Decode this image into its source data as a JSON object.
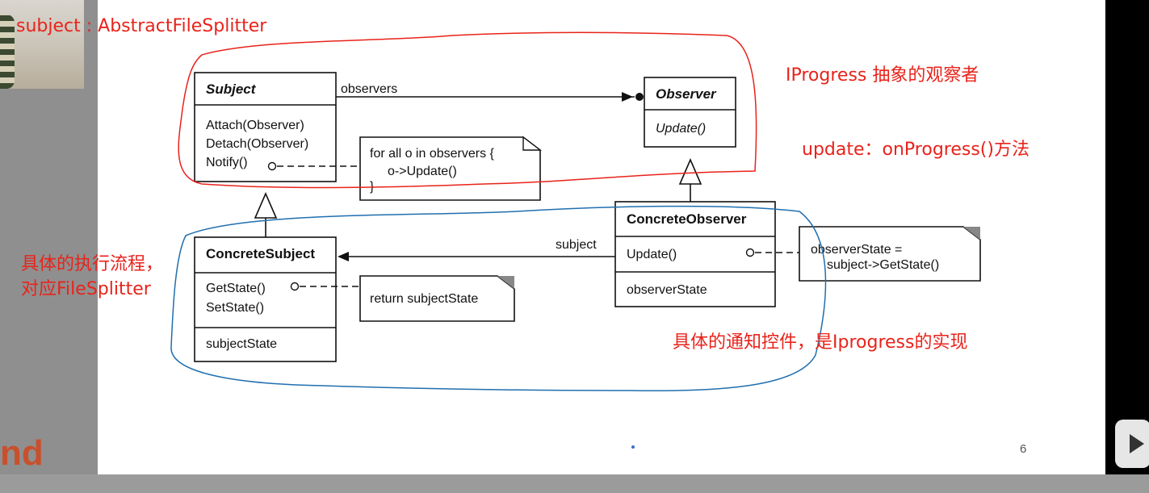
{
  "annotations": {
    "subject_label": "subject : AbstractFileSplitter",
    "iprogress_label": "IProgress 抽象的观察者",
    "update_label": "update：onProgress()方法",
    "left_note_line1": "具体的执行流程，",
    "left_note_line2": "对应FileSplitter",
    "bottom_note": "具体的通知控件，是Iprogress的实现"
  },
  "diagram": {
    "subject": {
      "name": "Subject",
      "methods": [
        "Attach(Observer)",
        "Detach(Observer)",
        "Notify()"
      ]
    },
    "observer": {
      "name": "Observer",
      "methods": [
        "Update()"
      ]
    },
    "concrete_subject": {
      "name": "ConcreteSubject",
      "methods": [
        "GetState()",
        "SetState()"
      ],
      "fields": [
        "subjectState"
      ]
    },
    "concrete_observer": {
      "name": "ConcreteObserver",
      "methods": [
        "Update()"
      ],
      "fields": [
        "observerState"
      ]
    },
    "observers_label": "observers",
    "subject_assoc_label": "subject",
    "note_notify": [
      "for all o in observers {",
      "o->Update()",
      "}"
    ],
    "note_getstate": "return subjectState",
    "note_update": [
      "observerState =",
      "subject->GetState()"
    ]
  },
  "slide": {
    "page_number": "6"
  },
  "colors": {
    "annotation_red": "#e8231b",
    "annotation_blue": "#1f6fb0",
    "slide_bg": "#ffffff",
    "outer_bg": "#9a9a9a"
  }
}
